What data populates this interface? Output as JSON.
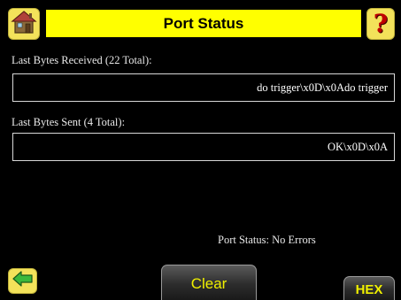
{
  "header": {
    "title": "Port Status",
    "home_icon": "home-icon",
    "help_icon": "help-icon",
    "help_glyph": "?"
  },
  "received": {
    "label": "Last Bytes Received (22 Total):",
    "value": "do trigger\\x0D\\x0Ado trigger"
  },
  "sent": {
    "label": "Last Bytes Sent (4 Total):",
    "value": "OK\\x0D\\x0A"
  },
  "status": {
    "text": "Port Status: No Errors"
  },
  "footer": {
    "back_icon": "back-arrow-icon",
    "clear_label": "Clear",
    "hex_label": "HEX"
  },
  "colors": {
    "title_bar": "#ffff00",
    "button_yellow": "#f3e25a",
    "button_text": "#f0f000",
    "help_mark": "#c00000",
    "arrow": "#3cb83c",
    "background": "#000000"
  }
}
